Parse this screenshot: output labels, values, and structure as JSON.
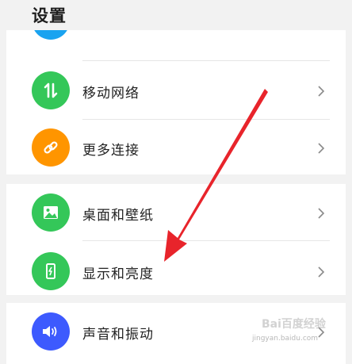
{
  "header": {
    "title": "设置"
  },
  "groups": [
    {
      "items": [
        {
          "label": "",
          "icon": "partial-blue-icon",
          "color": "#1aa3f0"
        },
        {
          "label": "移动网络",
          "icon": "mobile-data-icon",
          "color": "#34c759"
        },
        {
          "label": "更多连接",
          "icon": "link-icon",
          "color": "#ff9500"
        }
      ]
    },
    {
      "items": [
        {
          "label": "桌面和壁纸",
          "icon": "wallpaper-icon",
          "color": "#34c759"
        },
        {
          "label": "显示和亮度",
          "icon": "display-brightness-icon",
          "color": "#34c759"
        }
      ]
    },
    {
      "items": [
        {
          "label": "声音和振动",
          "icon": "speaker-icon",
          "color": "#3d5afe"
        }
      ]
    }
  ],
  "annotation": {
    "arrow_color": "#e8242b"
  },
  "watermark": {
    "text": "jingyan.baidu.com",
    "logo": "Bai百度经验"
  }
}
